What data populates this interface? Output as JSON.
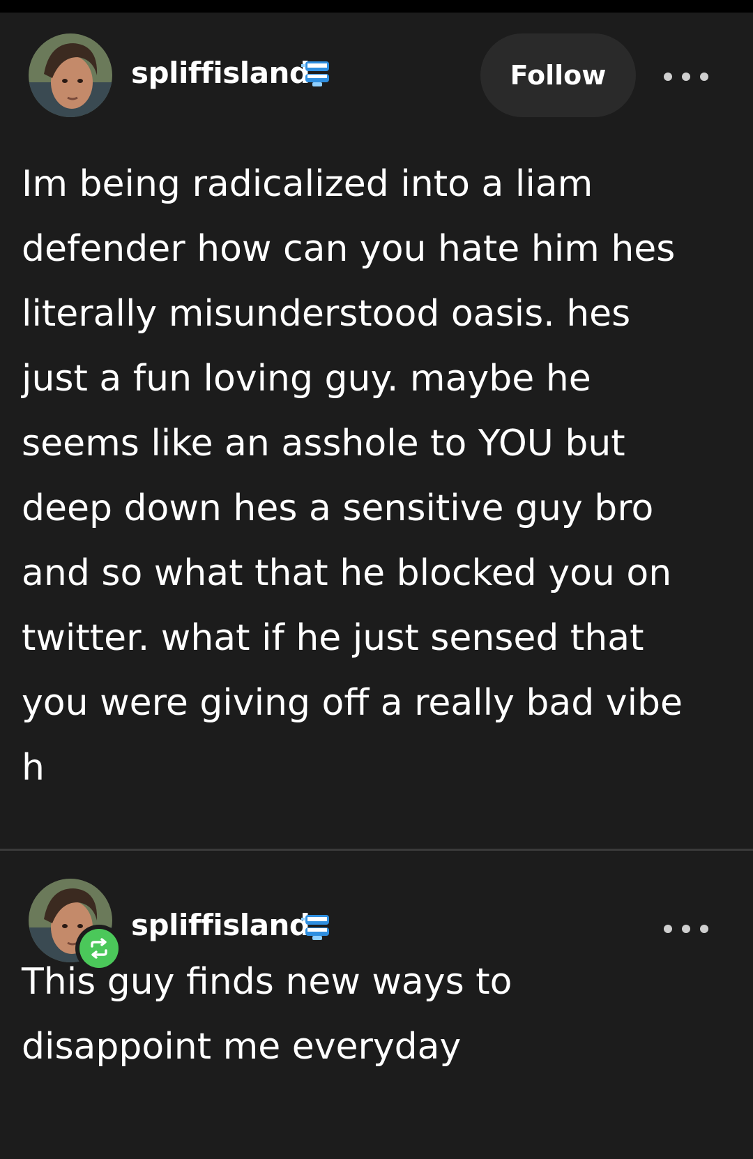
{
  "post1": {
    "username": "spliffisland",
    "follow_label": "Follow",
    "body_lines": [
      "Im being radicalized into a liam",
      "defender how can you hate him hes",
      "literally misunderstood oasis. hes",
      "just a fun loving guy. maybe he",
      "seems like an asshole to YOU but",
      "deep down hes a sensitive guy bro",
      "and so what that he blocked you on",
      "twitter. what if he just sensed that",
      "you were giving off a really bad vibe",
      "h"
    ]
  },
  "post2": {
    "username": "spliffisland",
    "body_lines": [
      "This guy finds new ways to",
      "disappoint me everyday"
    ]
  },
  "icons": {
    "badge": "chattering-teeth-icon",
    "more": "more-options-icon",
    "reblog": "reblog-icon"
  },
  "colors": {
    "background": "#1c1c1c",
    "follow_button_bg": "#2a2a2a",
    "reblog_green": "#4bc85a",
    "badge_blue": "#2f8fe0",
    "text": "#ffffff"
  }
}
